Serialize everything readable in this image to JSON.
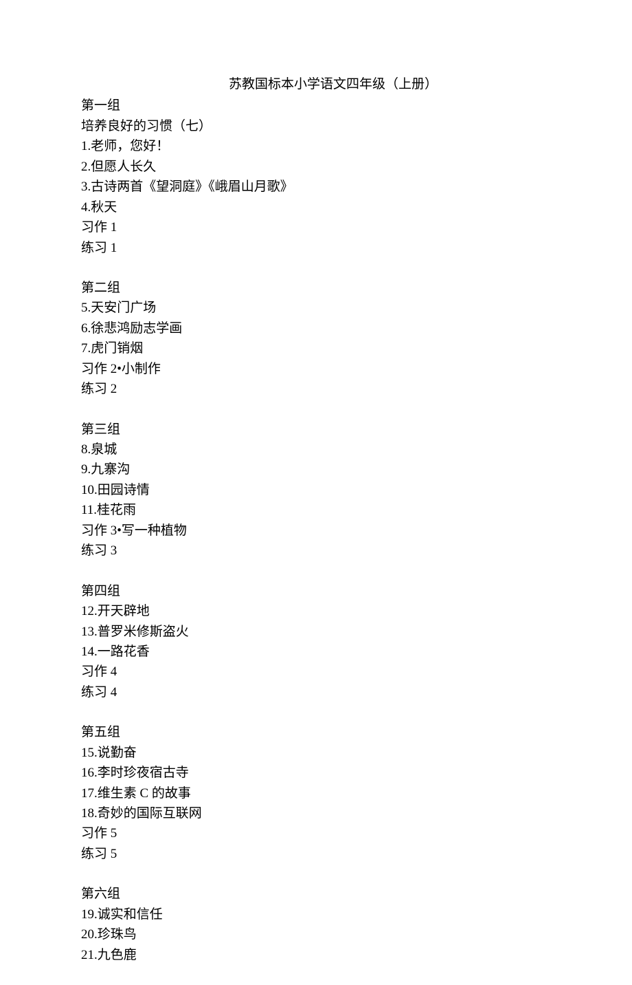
{
  "title": "苏教国标本小学语文四年级（上册）",
  "groups": [
    {
      "header": "第一组",
      "items": [
        "培养良好的习惯（七）",
        "1.老师，您好！",
        "2.但愿人长久",
        "3.古诗两首《望洞庭》《峨眉山月歌》",
        "4.秋天",
        "习作 1",
        "练习 1"
      ]
    },
    {
      "header": "第二组",
      "items": [
        "5.天安门广场",
        "6.徐悲鸿励志学画",
        "7.虎门销烟",
        "习作 2•小制作",
        "练习 2"
      ]
    },
    {
      "header": "第三组",
      "items": [
        "8.泉城",
        "9.九寨沟",
        "10.田园诗情",
        "11.桂花雨",
        "习作 3•写一种植物",
        "练习 3"
      ]
    },
    {
      "header": "第四组",
      "items": [
        "12.开天辟地",
        "13.普罗米修斯盗火",
        "14.一路花香",
        "习作 4",
        "练习 4"
      ]
    },
    {
      "header": "第五组",
      "items": [
        "15.说勤奋",
        "16.李时珍夜宿古寺",
        "17.维生素 C 的故事",
        "18.奇妙的国际互联网",
        "习作 5",
        "练习 5"
      ]
    },
    {
      "header": "第六组",
      "items": [
        "19.诚实和信任",
        "20.珍珠鸟",
        "21.九色鹿"
      ]
    }
  ]
}
